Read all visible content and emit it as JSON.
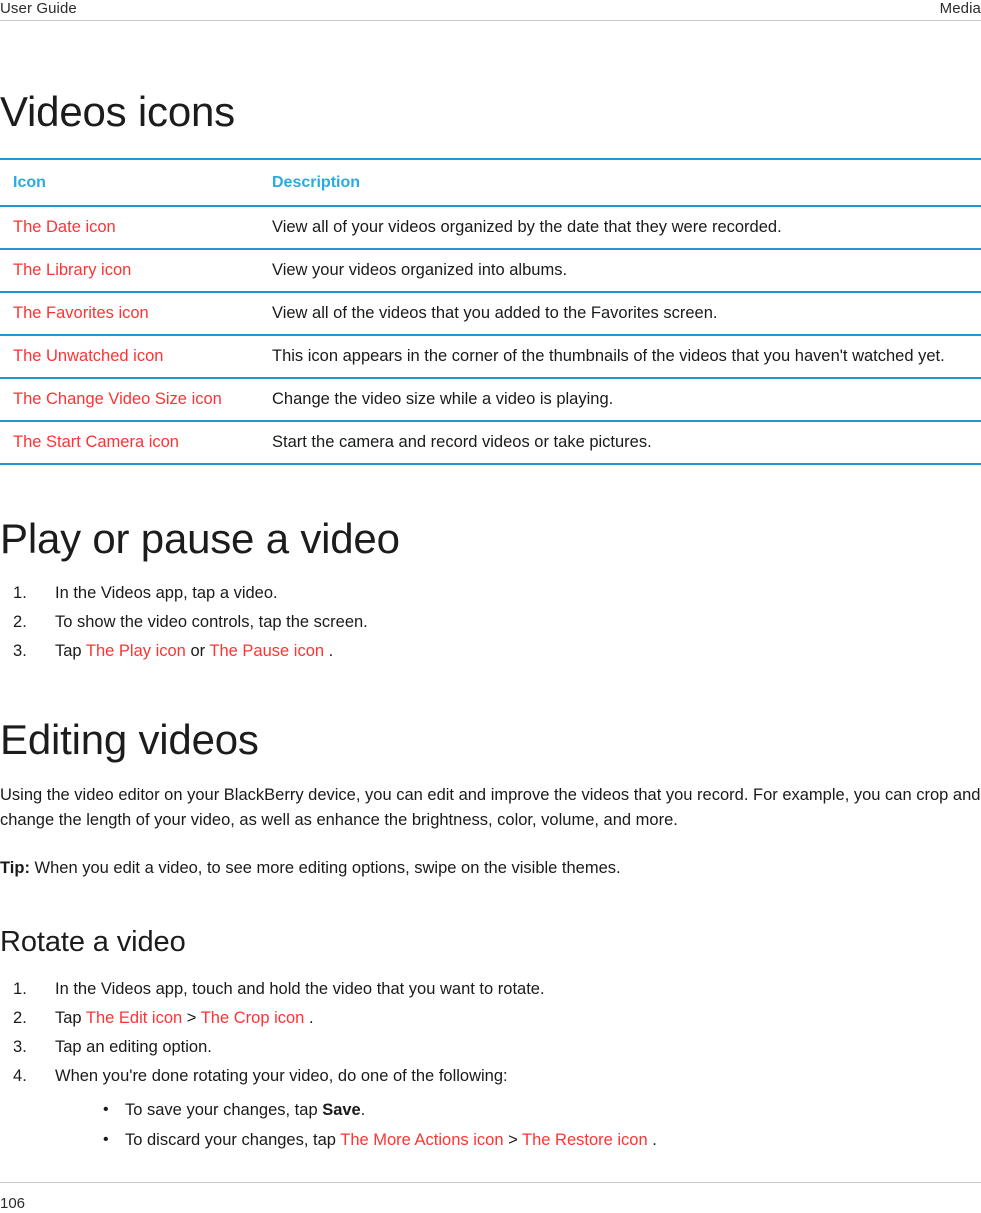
{
  "header": {
    "left": "User Guide",
    "right": "Media"
  },
  "footer": {
    "page_number": "106"
  },
  "colors": {
    "accent_blue": "#29abe2",
    "table_rule": "#2196cf",
    "broken_ref_red": "#ff3333",
    "body_text": "#1a1a1a",
    "header_rule": "#c9c9c9"
  },
  "sections": {
    "videos_icons": {
      "heading": "Videos icons",
      "table": {
        "columns": [
          "Icon",
          "Description"
        ],
        "rows": [
          {
            "icon": "The Date icon",
            "description": "View all of your videos organized by the date that they were recorded."
          },
          {
            "icon": "The Library icon",
            "description": "View your videos organized into albums."
          },
          {
            "icon": "The Favorites icon",
            "description": "View all of the videos that you added to the Favorites screen."
          },
          {
            "icon": "The Unwatched icon",
            "description": "This icon appears in the corner of the thumbnails of the videos that you haven't watched yet."
          },
          {
            "icon": "The Change Video Size icon",
            "description": "Change the video size while a video is playing."
          },
          {
            "icon": "The Start Camera icon",
            "description": "Start the camera and record videos or take pictures."
          }
        ]
      }
    },
    "play_or_pause": {
      "heading": "Play or pause a video",
      "steps": [
        {
          "text": "In the Videos app, tap a video."
        },
        {
          "text": "To show the video controls, tap the screen."
        },
        {
          "prefix": "Tap ",
          "ref1": "The Play icon",
          "middle": " or ",
          "ref2": "The Pause icon",
          "suffix": " ."
        }
      ]
    },
    "editing_videos": {
      "heading": "Editing videos",
      "paragraph": "Using the video editor on your BlackBerry device, you can edit and improve the videos that you record. For example, you can crop and change the length of your video, as well as enhance the brightness, color, volume, and more.",
      "tip_label": "Tip:",
      "tip_text": " When you edit a video, to see more editing options, swipe on the visible themes."
    },
    "rotate_a_video": {
      "heading": "Rotate a video",
      "steps": [
        {
          "text": "In the Videos app, touch and hold the video that you want to rotate."
        },
        {
          "prefix": "Tap ",
          "ref1": "The Edit icon",
          "middle": " > ",
          "ref2": "The Crop icon",
          "suffix": " ."
        },
        {
          "text": "Tap an editing option."
        },
        {
          "text": "When you're done rotating your video, do one of the following:"
        }
      ],
      "bullets": [
        {
          "prefix": " To save your changes, tap ",
          "bold": "Save",
          "suffix": "."
        },
        {
          "prefix": "To discard your changes, tap ",
          "ref1": "The More Actions icon",
          "middle": " > ",
          "ref2": "The Restore icon",
          "suffix": " ."
        }
      ]
    }
  }
}
